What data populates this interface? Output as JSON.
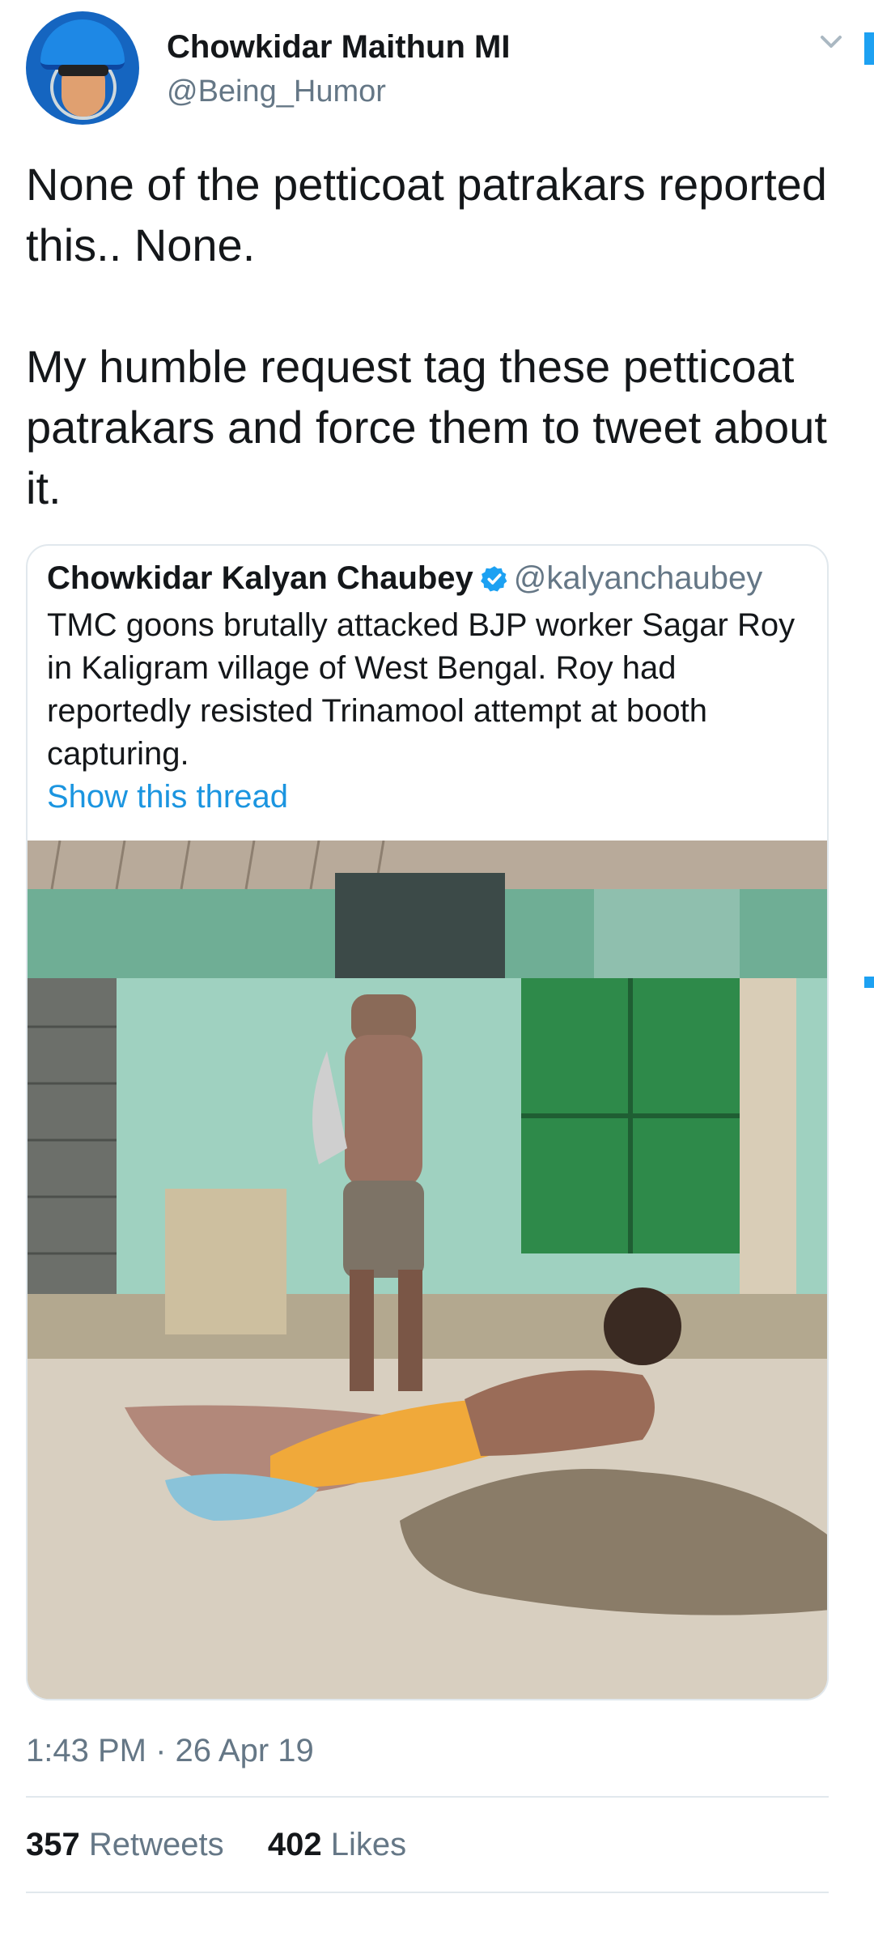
{
  "author": {
    "display_name": "Chowkidar Maithun MI",
    "handle": "@Being_Humor",
    "avatar_icon": "cricket-helmet-avatar"
  },
  "tweet": {
    "paragraphs": [
      "None of the petticoat patrakars reported this.. None.",
      "My humble request tag these petticoat patrakars and force them to tweet about it."
    ]
  },
  "quoted_tweet": {
    "display_name": "Chowkidar Kalyan Chaubey",
    "verified_icon": "verified-badge-icon",
    "handle": "@kalyanchaubey",
    "text": "TMC goons brutally attacked BJP worker Sagar Roy in Kaligram village of West Bengal. Roy had reportedly resisted Trinamool attempt at booth capturing.",
    "thread_link": "Show this thread"
  },
  "meta": {
    "timestamp": "1:43 PM · 26 Apr 19"
  },
  "stats": {
    "retweets_count": "357",
    "retweets_label": "Retweets",
    "likes_count": "402",
    "likes_label": "Likes"
  },
  "colors": {
    "link_blue": "#1b95e0",
    "secondary_text": "#657786",
    "primary_text": "#14171a",
    "verified_blue": "#1da1f2"
  }
}
